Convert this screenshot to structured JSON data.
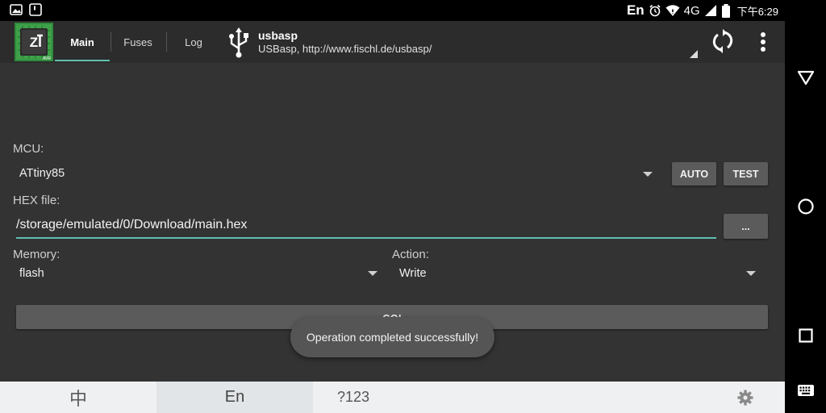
{
  "status_bar": {
    "input_indicator": "En",
    "network": "4G",
    "time": "下午6:29",
    "icons": [
      "image-icon",
      "notification-icon",
      "alarm-icon",
      "wifi-icon",
      "signal-icon",
      "battery-icon"
    ]
  },
  "toolbar": {
    "logo_badge": "AVR",
    "tabs": [
      {
        "label": "Main",
        "active": true
      },
      {
        "label": "Fuses",
        "active": false
      },
      {
        "label": "Log",
        "active": false
      }
    ],
    "programmer": {
      "name": "usbasp",
      "description": "USBasp, http://www.fischl.de/usbasp/"
    },
    "accent_color": "#5fbfae"
  },
  "form": {
    "mcu_label": "MCU:",
    "mcu_value": "ATtiny85",
    "auto_label": "AUTO",
    "test_label": "TEST",
    "hex_label": "HEX file:",
    "hex_value": "/storage/emulated/0/Download/main.hex",
    "browse_label": "...",
    "memory_label": "Memory:",
    "memory_value": "flash",
    "action_label": "Action:",
    "action_value": "Write",
    "go_label": "GO!"
  },
  "toast": {
    "message": "Operation completed successfully!"
  },
  "keyboard_bar": {
    "chinese_key": "中",
    "english_key": "En",
    "numbers_key": "?123"
  }
}
